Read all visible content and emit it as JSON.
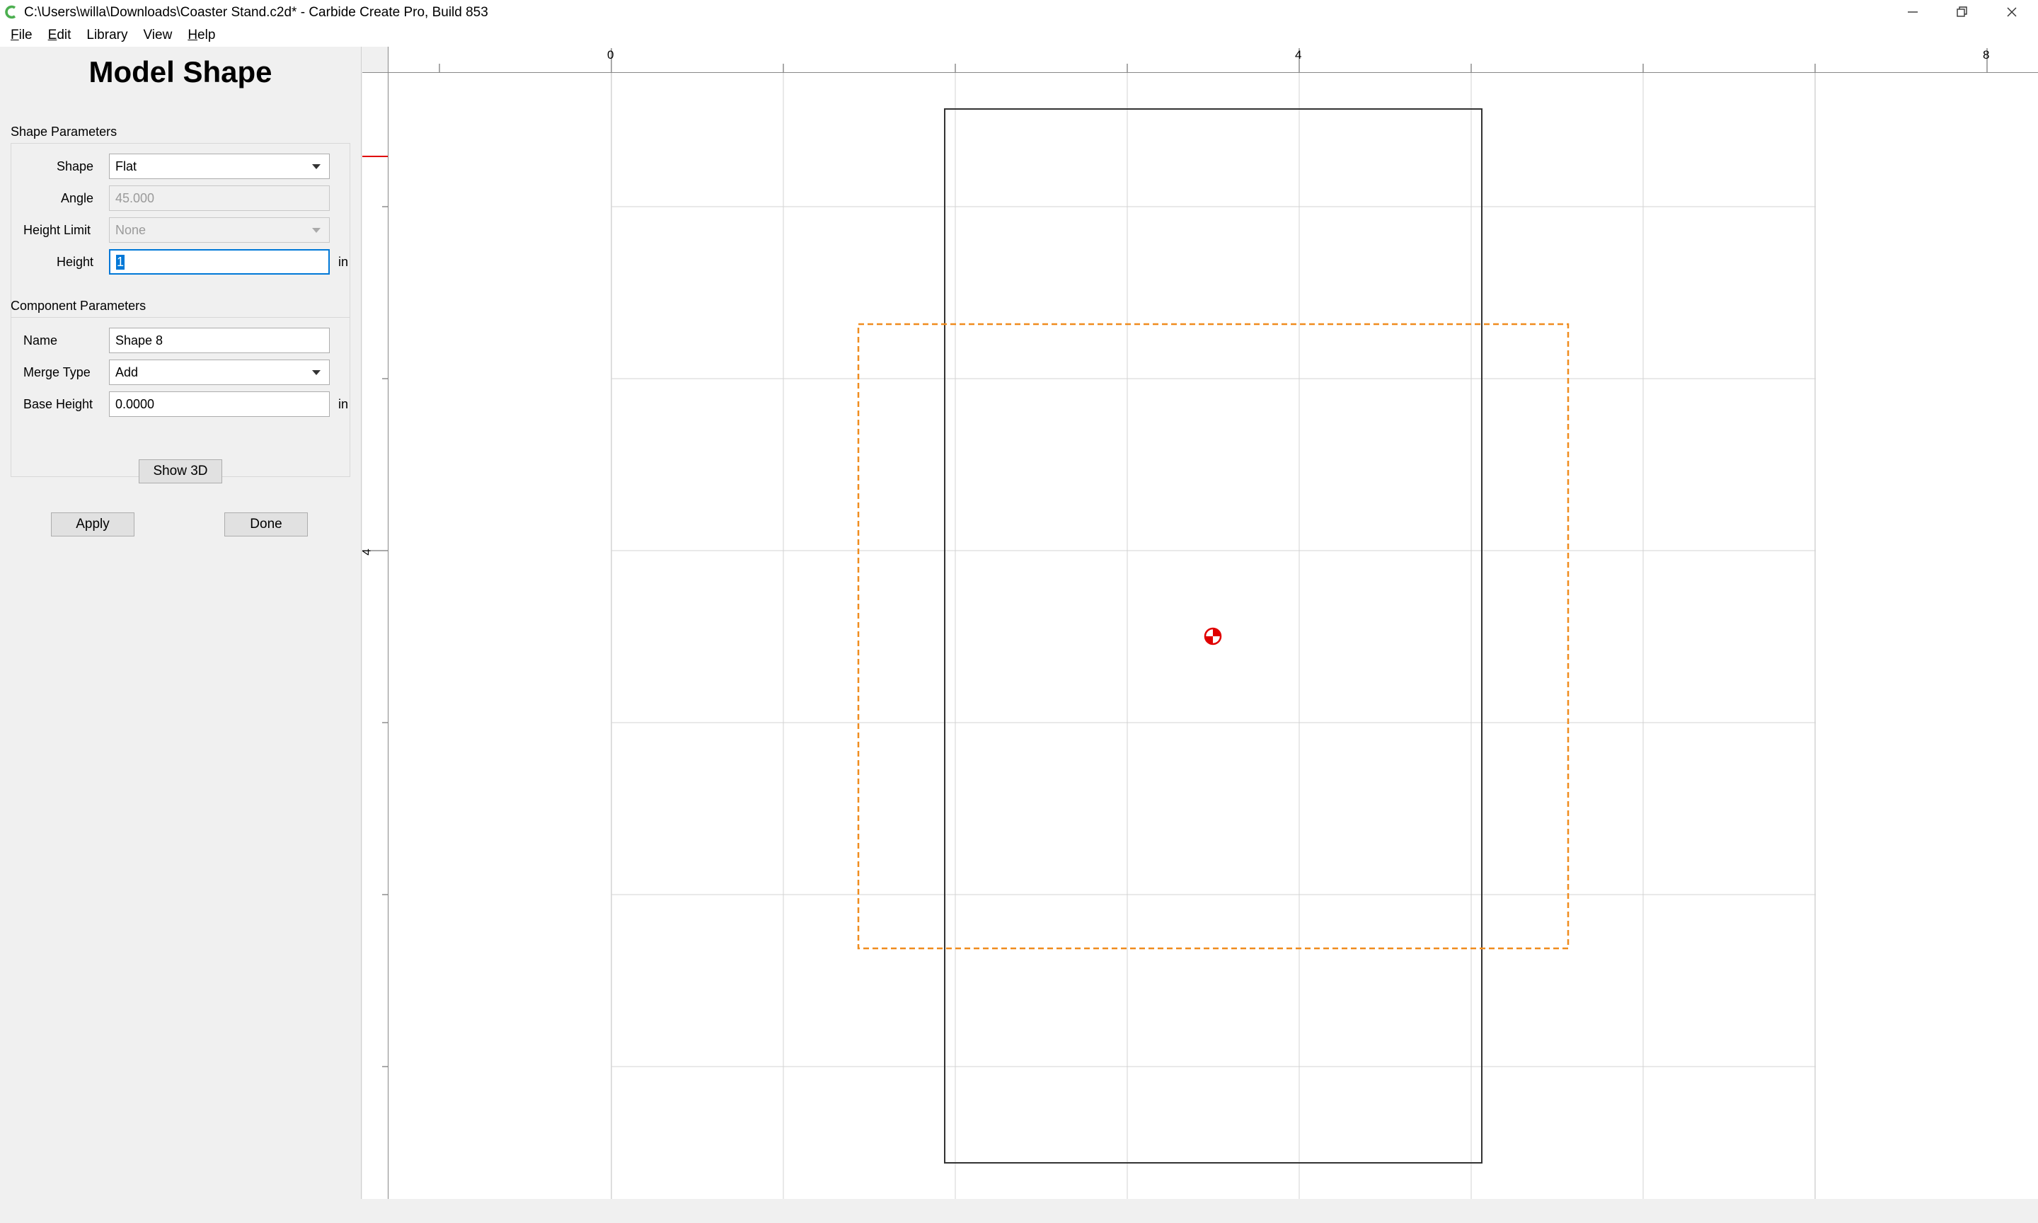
{
  "window": {
    "title": "C:\\Users\\willa\\Downloads\\Coaster Stand.c2d* - Carbide Create Pro, Build 853",
    "app_icon_color": "#4caf50"
  },
  "menu": {
    "items": [
      {
        "label": "File",
        "mnemonic": "F",
        "rest": "ile"
      },
      {
        "label": "Edit",
        "mnemonic": "E",
        "rest": "dit"
      },
      {
        "label": "Library",
        "mnemonic": "",
        "rest": "Library"
      },
      {
        "label": "View",
        "mnemonic": "",
        "rest": "View"
      },
      {
        "label": "Help",
        "mnemonic": "H",
        "rest": "elp"
      }
    ]
  },
  "panel": {
    "title": "Model Shape",
    "shape_params": {
      "section_label": "Shape Parameters",
      "shape": {
        "label": "Shape",
        "value": "Flat"
      },
      "angle": {
        "label": "Angle",
        "value": "45.000"
      },
      "height_limit": {
        "label": "Height Limit",
        "value": "None"
      },
      "height": {
        "label": "Height",
        "value": "1",
        "unit": "in"
      }
    },
    "component_params": {
      "section_label": "Component Parameters",
      "name": {
        "label": "Name",
        "value": "Shape 8"
      },
      "merge_type": {
        "label": "Merge Type",
        "value": "Add"
      },
      "base_height": {
        "label": "Base Height",
        "value": "0.0000",
        "unit": "in"
      }
    },
    "buttons": {
      "show3d": "Show 3D",
      "apply": "Apply",
      "done": "Done"
    }
  },
  "canvas": {
    "ruler_top_labels": [
      "0",
      "4",
      "8"
    ],
    "ruler_left_labels": [
      "4"
    ],
    "colors": {
      "grid": "#d3d3d3",
      "shape_outline": "#333333",
      "selection": "#f08c1e",
      "origin_marker": "#e00000",
      "ruler_cursor": "#e00000"
    }
  }
}
